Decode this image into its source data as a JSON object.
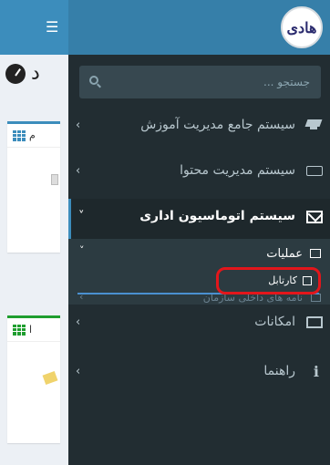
{
  "header": {
    "menu_toggle_icon": "hamburger-icon",
    "logo_text": "هادی"
  },
  "content": {
    "page_title": "د",
    "box1_title": "م",
    "box2_title": "ا"
  },
  "sidebar": {
    "search_placeholder": "جستجو ...",
    "items": [
      {
        "label": "سیستم جامع مدیریت آموزش",
        "icon": "graduation-cap-icon"
      },
      {
        "label": "سیستم مدیریت محتوا",
        "icon": "keyboard-icon"
      },
      {
        "label": "سیستم اتوماسیون اداری",
        "icon": "envelope-icon",
        "expanded": true
      },
      {
        "label": "امکانات",
        "icon": "folder-open-icon"
      },
      {
        "label": "راهنما",
        "icon": "info-icon"
      }
    ],
    "submenu": {
      "group_label": "عملیات",
      "group_icon": "folder-icon",
      "active_item": "کارتابل",
      "active_item_icon": "edit-icon",
      "next_item": "نامه های داخلی سازمان"
    }
  },
  "colors": {
    "sidebar_bg": "#222d32",
    "header_bg": "#3c8dbc",
    "highlight_border": "#e3161b"
  }
}
